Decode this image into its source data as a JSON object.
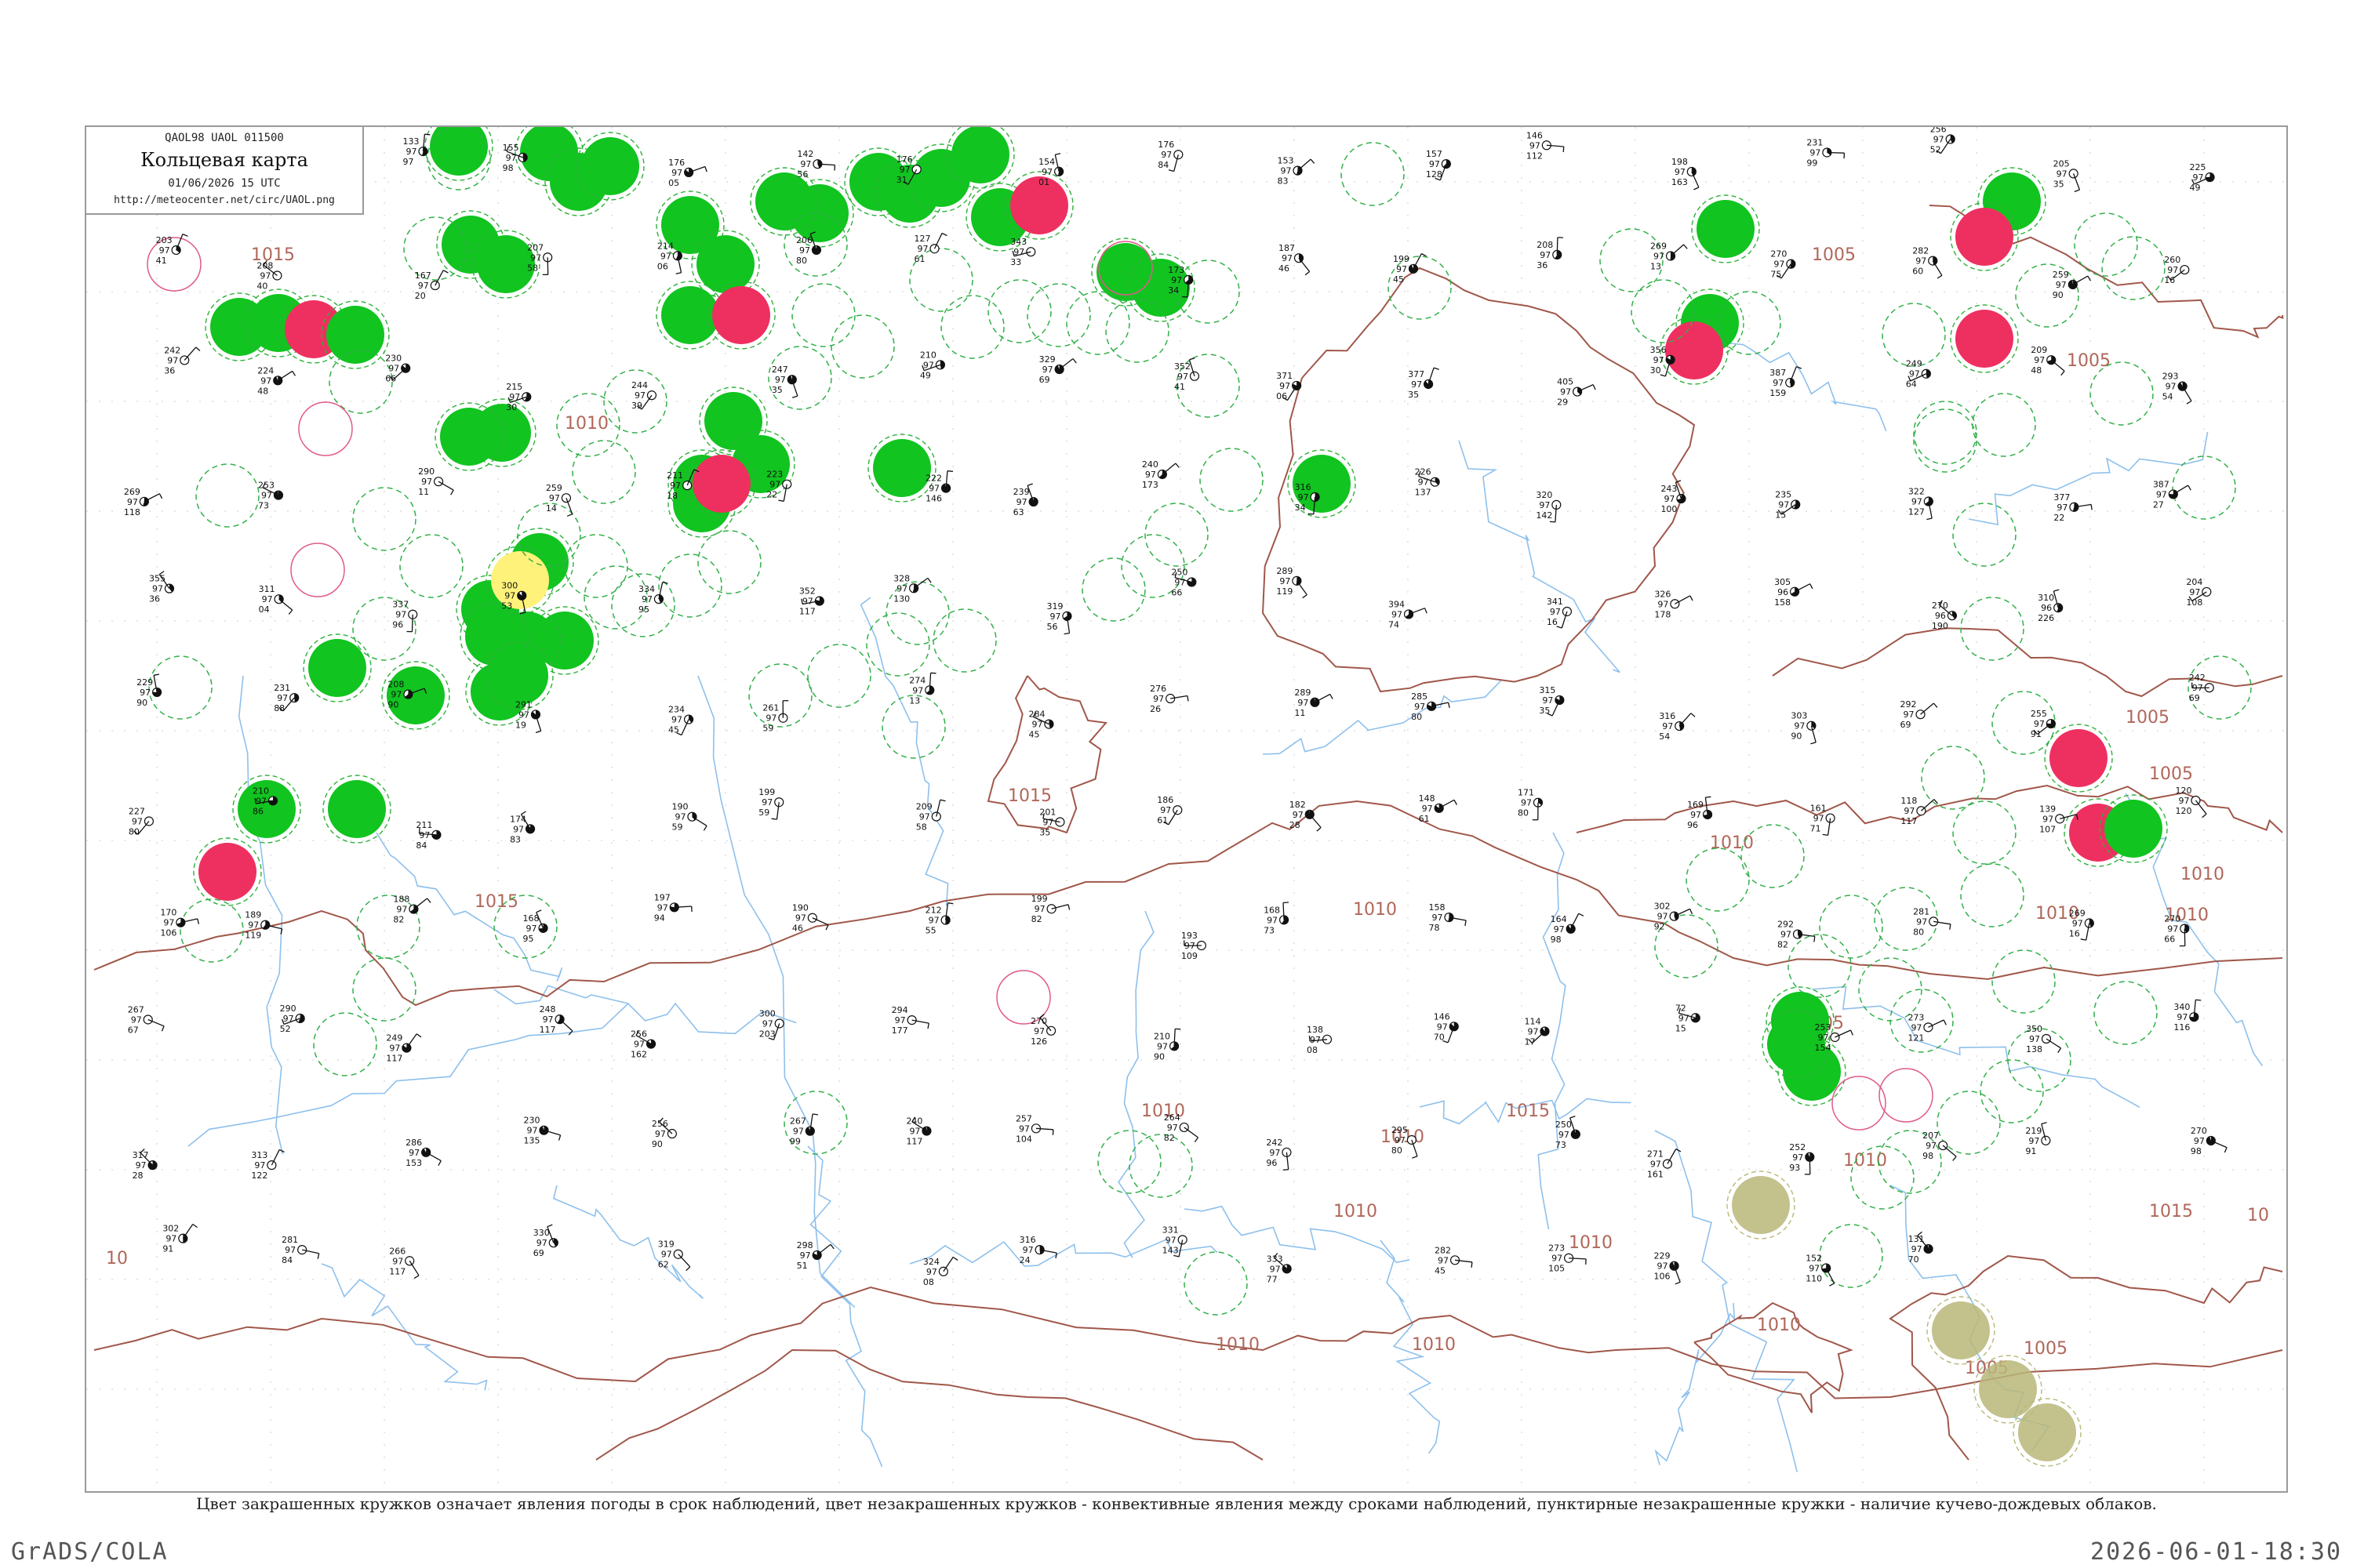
{
  "header": {
    "code": "QAOL98  UAOL  011500",
    "title": "Кольцевая карта",
    "date": "01/06/2026 15 UTC",
    "url": "http://meteocenter.net/circ/UAOL.png"
  },
  "caption": "Цвет закрашенных кружков означает явления погоды в срок наблюдений, цвет незакрашенных кружков - конвективные явления между сроками наблюдений, пунктирные незакрашенные кружки - наличие кучево-дождевых облаков.",
  "footer": {
    "left": "GrADS/COLA",
    "right": "2026-06-01-18:30"
  },
  "colors": {
    "isobar": "#a0574a",
    "river": "#8ec0ec",
    "rain": "#11c420",
    "thunder": "#ee3060",
    "haze": "#fff27a",
    "dust": "#b9b779",
    "cb_dashed": "#33b04a"
  },
  "isobar_labels": [
    "1015",
    "1015",
    "1010",
    "1010",
    "1015",
    "1010",
    "1010",
    "1005",
    "1005",
    "1010",
    "1010",
    "1015",
    "1010",
    "1010",
    "1010",
    "1010",
    "1005",
    "1005",
    "1005",
    "1010",
    "1010",
    "1015",
    "1010",
    "1010",
    "1005",
    "1005",
    "10",
    "10"
  ],
  "stations": [
    {
      "p": "187",
      "t": "97",
      "d": "52",
      "name": ""
    },
    {
      "p": "140",
      "t": "97",
      "d": "94",
      "name": ""
    },
    {
      "p": "133",
      "t": "97",
      "d": "97",
      "name": ""
    },
    {
      "p": "155",
      "t": "97",
      "d": "98",
      "name": ""
    },
    {
      "p": "176",
      "t": "97",
      "d": "05",
      "name": ""
    },
    {
      "p": "142",
      "t": "97",
      "d": "56",
      "name": ""
    },
    {
      "p": "176",
      "t": "97",
      "d": "31",
      "name": ""
    },
    {
      "p": "154",
      "t": "97",
      "d": "01",
      "name": ""
    },
    {
      "p": "176",
      "t": "97",
      "d": "84",
      "name": ""
    },
    {
      "p": "153",
      "t": "97",
      "d": "83",
      "name": ""
    },
    {
      "p": "157",
      "t": "97",
      "d": "128",
      "name": ""
    },
    {
      "p": "146",
      "t": "97",
      "d": "112",
      "name": ""
    },
    {
      "p": "198",
      "t": "97",
      "d": "163",
      "name": ""
    },
    {
      "p": "231",
      "t": "97",
      "d": "99",
      "name": ""
    },
    {
      "p": "256",
      "t": "97",
      "d": "52",
      "name": ""
    },
    {
      "p": "205",
      "t": "97",
      "d": "35",
      "name": ""
    },
    {
      "p": "225",
      "t": "97",
      "d": "49",
      "name": ""
    },
    {
      "p": "203",
      "t": "97",
      "d": "41",
      "name": ""
    },
    {
      "p": "208",
      "t": "97",
      "d": "40",
      "name": ""
    },
    {
      "p": "167",
      "t": "97",
      "d": "20",
      "name": ""
    },
    {
      "p": "207",
      "t": "97",
      "d": "58",
      "name": ""
    },
    {
      "p": "214",
      "t": "97",
      "d": "06",
      "name": ""
    },
    {
      "p": "206",
      "t": "97",
      "d": "80",
      "name": ""
    },
    {
      "p": "127",
      "t": "97",
      "d": "61",
      "name": ""
    },
    {
      "p": "343",
      "t": "97",
      "d": "33",
      "name": ""
    },
    {
      "p": "173",
      "t": "97",
      "d": "34",
      "name": ""
    },
    {
      "p": "187",
      "t": "97",
      "d": "46",
      "name": ""
    },
    {
      "p": "199",
      "t": "97",
      "d": "45",
      "name": ""
    },
    {
      "p": "208",
      "t": "97",
      "d": "36",
      "name": ""
    },
    {
      "p": "269",
      "t": "97",
      "d": "13",
      "name": ""
    },
    {
      "p": "270",
      "t": "97",
      "d": "75",
      "name": ""
    },
    {
      "p": "282",
      "t": "97",
      "d": "60",
      "name": ""
    },
    {
      "p": "259",
      "t": "97",
      "d": "90",
      "name": ""
    },
    {
      "p": "260",
      "t": "97",
      "d": "16",
      "name": ""
    },
    {
      "p": "242",
      "t": "97",
      "d": "36",
      "name": ""
    },
    {
      "p": "224",
      "t": "97",
      "d": "48",
      "name": ""
    },
    {
      "p": "230",
      "t": "97",
      "d": "66",
      "name": ""
    },
    {
      "p": "215",
      "t": "97",
      "d": "30",
      "name": ""
    },
    {
      "p": "244",
      "t": "97",
      "d": "39",
      "name": ""
    },
    {
      "p": "247",
      "t": "97",
      "d": "35",
      "name": ""
    },
    {
      "p": "210",
      "t": "97",
      "d": "49",
      "name": ""
    },
    {
      "p": "329",
      "t": "97",
      "d": "69",
      "name": ""
    },
    {
      "p": "352",
      "t": "97",
      "d": "41",
      "name": ""
    },
    {
      "p": "371",
      "t": "97",
      "d": "06",
      "name": ""
    },
    {
      "p": "377",
      "t": "97",
      "d": "35",
      "name": ""
    },
    {
      "p": "405",
      "t": "97",
      "d": "29",
      "name": ""
    },
    {
      "p": "356",
      "t": "97",
      "d": "30",
      "name": ""
    },
    {
      "p": "387",
      "t": "97",
      "d": "159",
      "name": ""
    },
    {
      "p": "249",
      "t": "97",
      "d": "64",
      "name": ""
    },
    {
      "p": "209",
      "t": "97",
      "d": "48",
      "name": ""
    },
    {
      "p": "293",
      "t": "97",
      "d": "54",
      "name": ""
    },
    {
      "p": "269",
      "t": "97",
      "d": "118",
      "name": ""
    },
    {
      "p": "253",
      "t": "97",
      "d": "73",
      "name": ""
    },
    {
      "p": "290",
      "t": "97",
      "d": "11",
      "name": ""
    },
    {
      "p": "259",
      "t": "97",
      "d": "14",
      "name": ""
    },
    {
      "p": "211",
      "t": "97",
      "d": "18",
      "name": ""
    },
    {
      "p": "223",
      "t": "97",
      "d": "22",
      "name": ""
    },
    {
      "p": "222",
      "t": "97",
      "d": "146",
      "name": ""
    },
    {
      "p": "239",
      "t": "97",
      "d": "63",
      "name": ""
    },
    {
      "p": "240",
      "t": "97",
      "d": "173",
      "name": ""
    },
    {
      "p": "316",
      "t": "97",
      "d": "34",
      "name": ""
    },
    {
      "p": "226",
      "t": "97",
      "d": "137",
      "name": ""
    },
    {
      "p": "320",
      "t": "97",
      "d": "142",
      "name": ""
    },
    {
      "p": "243",
      "t": "97",
      "d": "100",
      "name": ""
    },
    {
      "p": "235",
      "t": "97",
      "d": "15",
      "name": ""
    },
    {
      "p": "322",
      "t": "97",
      "d": "127",
      "name": ""
    },
    {
      "p": "377",
      "t": "97",
      "d": "22",
      "name": ""
    },
    {
      "p": "387",
      "t": "97",
      "d": "27",
      "name": ""
    },
    {
      "p": "355",
      "t": "97",
      "d": "36",
      "name": ""
    },
    {
      "p": "311",
      "t": "97",
      "d": "04",
      "name": ""
    },
    {
      "p": "337",
      "t": "97",
      "d": "96",
      "name": ""
    },
    {
      "p": "300",
      "t": "97",
      "d": "53",
      "name": ""
    },
    {
      "p": "334",
      "t": "97",
      "d": "95",
      "name": ""
    },
    {
      "p": "352",
      "t": "97",
      "d": "117",
      "name": ""
    },
    {
      "p": "328",
      "t": "97",
      "d": "130",
      "name": ""
    },
    {
      "p": "319",
      "t": "97",
      "d": "56",
      "name": ""
    },
    {
      "p": "250",
      "t": "97",
      "d": "66",
      "name": ""
    },
    {
      "p": "289",
      "t": "97",
      "d": "119",
      "name": ""
    },
    {
      "p": "394",
      "t": "97",
      "d": "74",
      "name": ""
    },
    {
      "p": "341",
      "t": "97",
      "d": "16",
      "name": ""
    },
    {
      "p": "326",
      "t": "97",
      "d": "178",
      "name": ""
    },
    {
      "p": "305",
      "t": "96",
      "d": "158",
      "name": ""
    },
    {
      "p": "270",
      "t": "96",
      "d": "190",
      "name": ""
    },
    {
      "p": "310",
      "t": "96",
      "d": "226",
      "name": ""
    },
    {
      "p": "204",
      "t": "97",
      "d": "108",
      "name": ""
    },
    {
      "p": "229",
      "t": "97",
      "d": "90",
      "name": ""
    },
    {
      "p": "231",
      "t": "97",
      "d": "88",
      "name": ""
    },
    {
      "p": "208",
      "t": "97",
      "d": "90",
      "name": ""
    },
    {
      "p": "291",
      "t": "97",
      "d": "19",
      "name": ""
    },
    {
      "p": "234",
      "t": "97",
      "d": "45",
      "name": ""
    },
    {
      "p": "261",
      "t": "97",
      "d": "59",
      "name": ""
    },
    {
      "p": "274",
      "t": "97",
      "d": "13",
      "name": ""
    },
    {
      "p": "284",
      "t": "97",
      "d": "45",
      "name": ""
    },
    {
      "p": "276",
      "t": "97",
      "d": "26",
      "name": ""
    },
    {
      "p": "289",
      "t": "97",
      "d": "11",
      "name": ""
    },
    {
      "p": "285",
      "t": "97",
      "d": "80",
      "name": ""
    },
    {
      "p": "315",
      "t": "97",
      "d": "35",
      "name": ""
    },
    {
      "p": "316",
      "t": "97",
      "d": "54",
      "name": ""
    },
    {
      "p": "303",
      "t": "97",
      "d": "90",
      "name": ""
    },
    {
      "p": "292",
      "t": "97",
      "d": "69",
      "name": ""
    },
    {
      "p": "255",
      "t": "97",
      "d": "91",
      "name": ""
    },
    {
      "p": "242",
      "t": "97",
      "d": "69",
      "name": ""
    },
    {
      "p": "227",
      "t": "97",
      "d": "80",
      "name": ""
    },
    {
      "p": "210",
      "t": "97",
      "d": "86",
      "name": ""
    },
    {
      "p": "211",
      "t": "97",
      "d": "84",
      "name": ""
    },
    {
      "p": "174",
      "t": "97",
      "d": "83",
      "name": ""
    },
    {
      "p": "190",
      "t": "97",
      "d": "59",
      "name": ""
    },
    {
      "p": "199",
      "t": "97",
      "d": "59",
      "name": ""
    },
    {
      "p": "209",
      "t": "97",
      "d": "58",
      "name": ""
    },
    {
      "p": "201",
      "t": "97",
      "d": "35",
      "name": ""
    },
    {
      "p": "186",
      "t": "97",
      "d": "61",
      "name": ""
    },
    {
      "p": "182",
      "t": "97",
      "d": "28",
      "name": ""
    },
    {
      "p": "148",
      "t": "97",
      "d": "61",
      "name": ""
    },
    {
      "p": "171",
      "t": "97",
      "d": "80",
      "name": ""
    },
    {
      "p": "169",
      "t": "97",
      "d": "96",
      "name": ""
    },
    {
      "p": "161",
      "t": "97",
      "d": "71",
      "name": ""
    },
    {
      "p": "118",
      "t": "97",
      "d": "117",
      "name": ""
    },
    {
      "p": "139",
      "t": "97",
      "d": "107",
      "name": ""
    },
    {
      "p": "120",
      "t": "97",
      "d": "120",
      "name": ""
    },
    {
      "p": "170",
      "t": "97",
      "d": "106",
      "name": ""
    },
    {
      "p": "189",
      "t": "97",
      "d": "119",
      "name": ""
    },
    {
      "p": "188",
      "t": "97",
      "d": "82",
      "name": ""
    },
    {
      "p": "168",
      "t": "97",
      "d": "95",
      "name": ""
    },
    {
      "p": "197",
      "t": "97",
      "d": "94",
      "name": ""
    },
    {
      "p": "190",
      "t": "97",
      "d": "46",
      "name": ""
    },
    {
      "p": "212",
      "t": "97",
      "d": "55",
      "name": ""
    },
    {
      "p": "199",
      "t": "97",
      "d": "82",
      "name": ""
    },
    {
      "p": "193",
      "t": "97",
      "d": "109",
      "name": ""
    },
    {
      "p": "168",
      "t": "97",
      "d": "73",
      "name": ""
    },
    {
      "p": "158",
      "t": "97",
      "d": "78",
      "name": ""
    },
    {
      "p": "164",
      "t": "97",
      "d": "98",
      "name": ""
    },
    {
      "p": "302",
      "t": "97",
      "d": "92",
      "name": ""
    },
    {
      "p": "292",
      "t": "97",
      "d": "82",
      "name": ""
    },
    {
      "p": "281",
      "t": "97",
      "d": "80",
      "name": ""
    },
    {
      "p": "269",
      "t": "97",
      "d": "16",
      "name": ""
    },
    {
      "p": "270",
      "t": "97",
      "d": "66",
      "name": ""
    },
    {
      "p": "267",
      "t": "97",
      "d": "67",
      "name": ""
    },
    {
      "p": "290",
      "t": "97",
      "d": "52",
      "name": ""
    },
    {
      "p": "249",
      "t": "97",
      "d": "117",
      "name": ""
    },
    {
      "p": "248",
      "t": "97",
      "d": "117",
      "name": ""
    },
    {
      "p": "256",
      "t": "97",
      "d": "162",
      "name": ""
    },
    {
      "p": "300",
      "t": "97",
      "d": "203",
      "name": ""
    },
    {
      "p": "294",
      "t": "97",
      "d": "177",
      "name": ""
    },
    {
      "p": "270",
      "t": "97",
      "d": "126",
      "name": ""
    },
    {
      "p": "210",
      "t": "97",
      "d": "90",
      "name": ""
    },
    {
      "p": "138",
      "t": "97",
      "d": "08",
      "name": ""
    },
    {
      "p": "146",
      "t": "97",
      "d": "70",
      "name": ""
    },
    {
      "p": "114",
      "t": "97",
      "d": "17",
      "name": ""
    },
    {
      "p": "72",
      "t": "97",
      "d": "15",
      "name": ""
    },
    {
      "p": "253",
      "t": "97",
      "d": "154",
      "name": ""
    },
    {
      "p": "273",
      "t": "97",
      "d": "121",
      "name": ""
    },
    {
      "p": "350",
      "t": "97",
      "d": "138",
      "name": ""
    },
    {
      "p": "340",
      "t": "97",
      "d": "116",
      "name": ""
    },
    {
      "p": "317",
      "t": "97",
      "d": "28",
      "name": ""
    },
    {
      "p": "313",
      "t": "97",
      "d": "122",
      "name": ""
    },
    {
      "p": "286",
      "t": "97",
      "d": "153",
      "name": ""
    },
    {
      "p": "230",
      "t": "97",
      "d": "135",
      "name": ""
    },
    {
      "p": "256",
      "t": "97",
      "d": "90",
      "name": ""
    },
    {
      "p": "267",
      "t": "97",
      "d": "99",
      "name": ""
    },
    {
      "p": "240",
      "t": "97",
      "d": "117",
      "name": ""
    },
    {
      "p": "257",
      "t": "97",
      "d": "104",
      "name": ""
    },
    {
      "p": "264",
      "t": "97",
      "d": "82",
      "name": ""
    },
    {
      "p": "242",
      "t": "97",
      "d": "96",
      "name": ""
    },
    {
      "p": "295",
      "t": "97",
      "d": "80",
      "name": ""
    },
    {
      "p": "250",
      "t": "97",
      "d": "73",
      "name": ""
    },
    {
      "p": "271",
      "t": "97",
      "d": "161",
      "name": ""
    },
    {
      "p": "252",
      "t": "97",
      "d": "93",
      "name": ""
    },
    {
      "p": "207",
      "t": "97",
      "d": "98",
      "name": ""
    },
    {
      "p": "219",
      "t": "97",
      "d": "91",
      "name": ""
    },
    {
      "p": "270",
      "t": "97",
      "d": "98",
      "name": ""
    },
    {
      "p": "302",
      "t": "97",
      "d": "91",
      "name": ""
    },
    {
      "p": "281",
      "t": "97",
      "d": "84",
      "name": ""
    },
    {
      "p": "266",
      "t": "97",
      "d": "117",
      "name": ""
    },
    {
      "p": "330",
      "t": "97",
      "d": "69",
      "name": ""
    },
    {
      "p": "319",
      "t": "97",
      "d": "62",
      "name": ""
    },
    {
      "p": "298",
      "t": "97",
      "d": "51",
      "name": ""
    },
    {
      "p": "324",
      "t": "97",
      "d": "08",
      "name": ""
    },
    {
      "p": "316",
      "t": "97",
      "d": "24",
      "name": ""
    },
    {
      "p": "331",
      "t": "97",
      "d": "143",
      "name": ""
    },
    {
      "p": "333",
      "t": "97",
      "d": "77",
      "name": ""
    },
    {
      "p": "282",
      "t": "97",
      "d": "45",
      "name": ""
    },
    {
      "p": "273",
      "t": "97",
      "d": "105",
      "name": ""
    },
    {
      "p": "229",
      "t": "97",
      "d": "106",
      "name": ""
    },
    {
      "p": "152",
      "t": "97",
      "d": "110",
      "name": ""
    },
    {
      "p": "131",
      "t": "97",
      "d": "70",
      "name": ""
    }
  ]
}
